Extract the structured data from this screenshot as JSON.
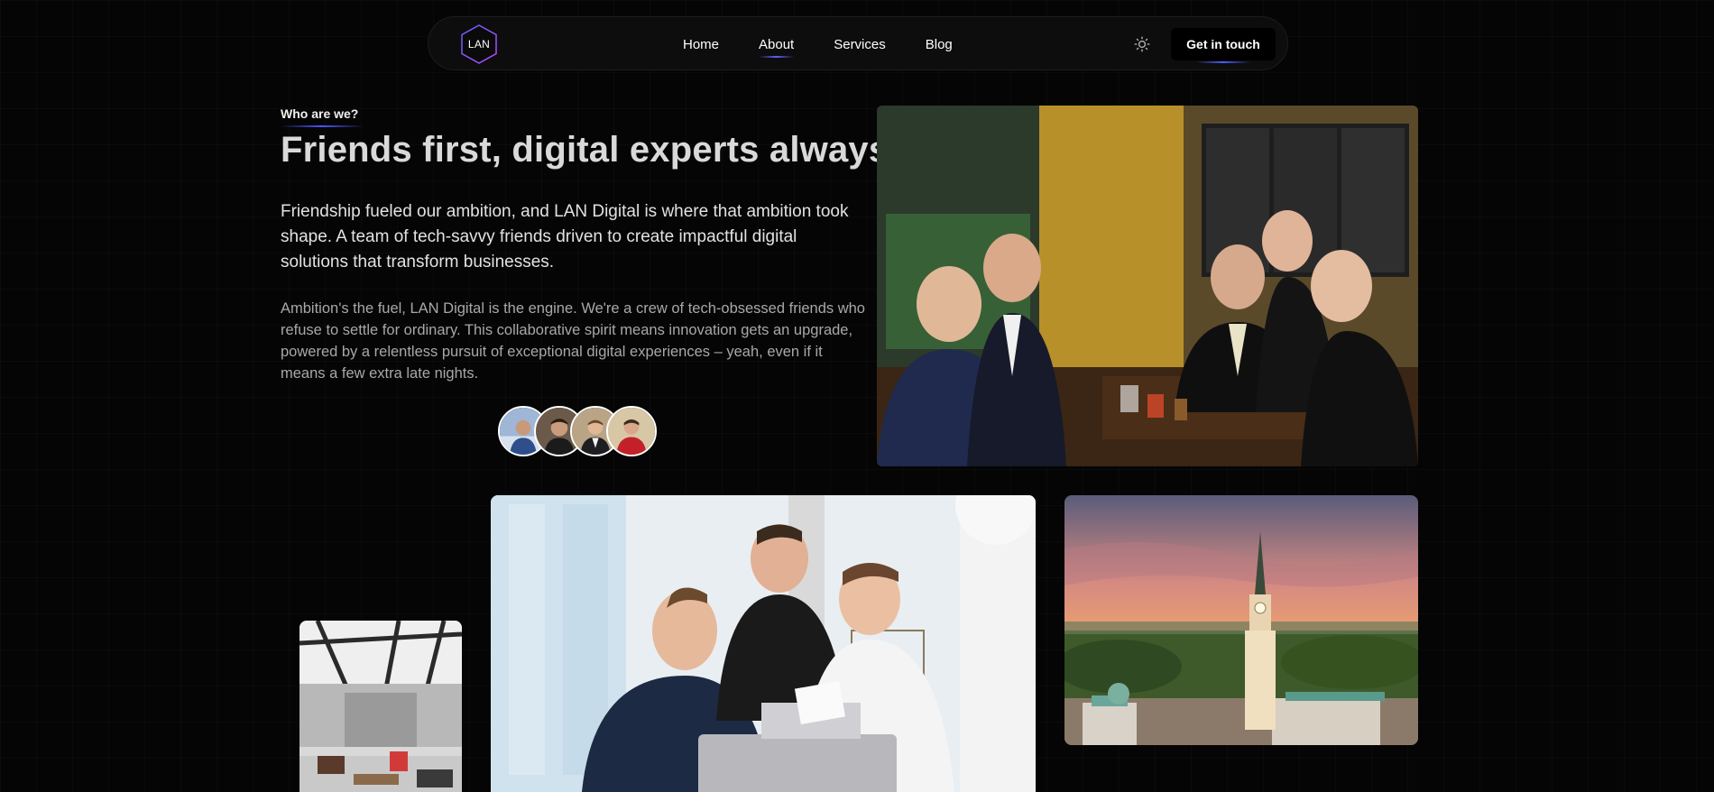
{
  "nav": {
    "logo_text": "LAN",
    "links": [
      {
        "label": "Home"
      },
      {
        "label": "About"
      },
      {
        "label": "Services"
      },
      {
        "label": "Blog"
      }
    ],
    "active_link": "About",
    "theme_toggle_icon": "sun-icon",
    "cta_label": "Get in touch"
  },
  "about": {
    "eyebrow": "Who are we?",
    "headline": "Friends first, digital experts always.",
    "lead": "Friendship fueled our ambition, and LAN Digital is where that ambition took shape. A team of tech-savvy friends driven to create impactful digital solutions that transform businesses.",
    "body": "Ambition's the fuel, LAN Digital is the engine. We're a crew of tech-obsessed friends who refuse to settle for ordinary. This collaborative spirit means innovation gets an upgrade, powered by a relentless pursuit of exceptional digital experiences – yeah, even if it means a few extra late nights."
  },
  "team_avatars": [
    {
      "name": "team-member-1"
    },
    {
      "name": "team-member-2"
    },
    {
      "name": "team-member-3"
    },
    {
      "name": "team-member-4"
    }
  ],
  "gallery": [
    {
      "subject": "Group photo of friends at a bar table"
    },
    {
      "subject": "Modern open office interior"
    },
    {
      "subject": "Three team members working on a laptop"
    },
    {
      "subject": "City skyline with church tower at sunset"
    }
  ],
  "colors": {
    "background": "#050505",
    "accent": "#4b57ff",
    "nav_background": "#0d0d0d",
    "text_primary": "#e2e2e2",
    "text_secondary": "#a8a8a8"
  }
}
